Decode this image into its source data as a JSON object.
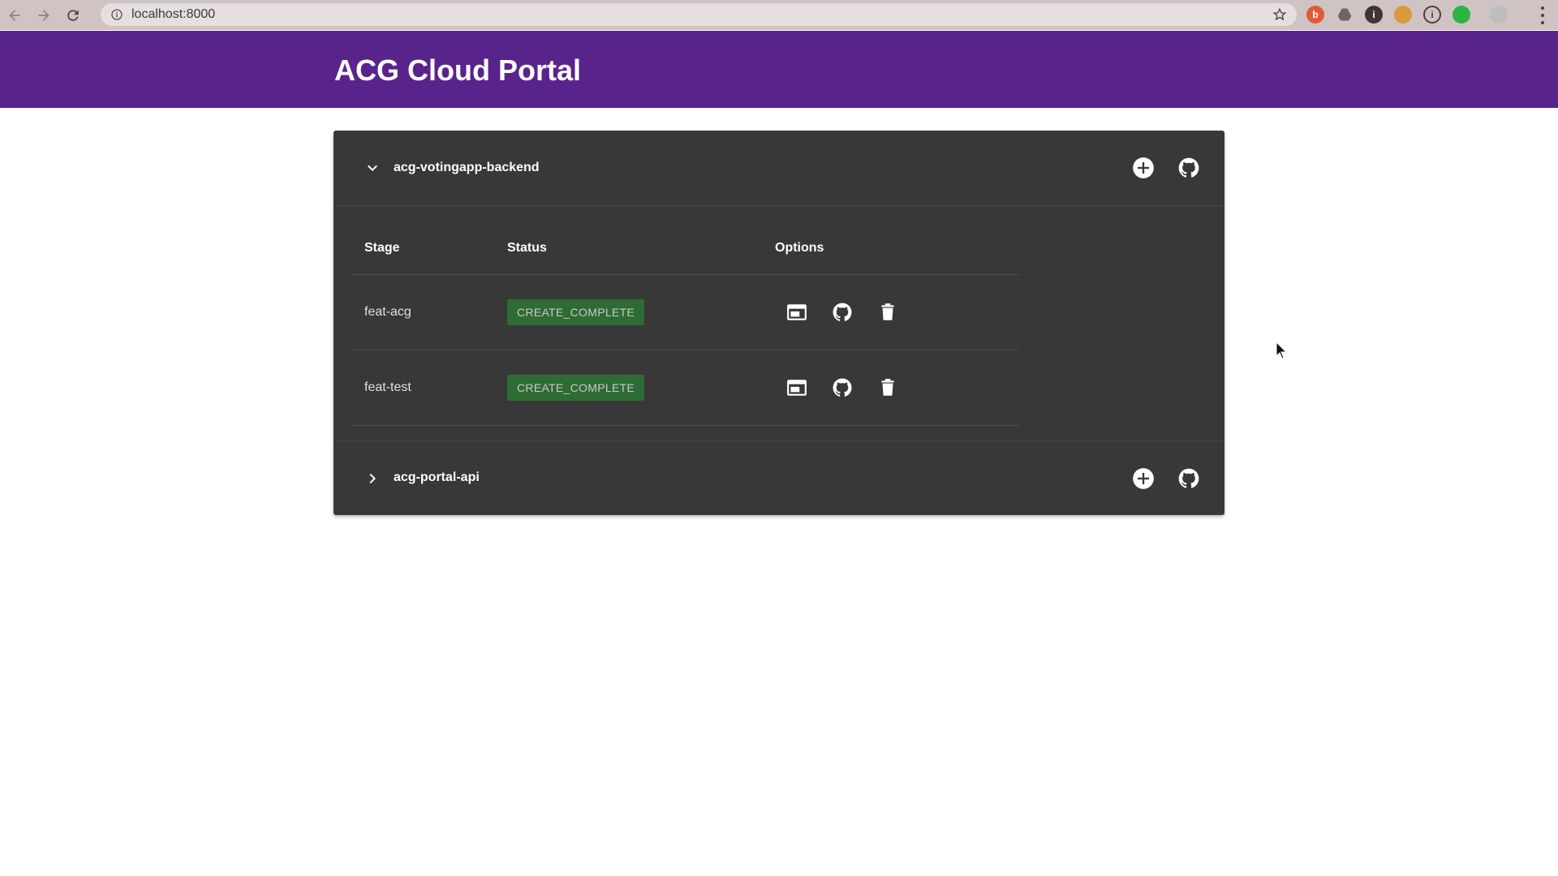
{
  "browser": {
    "url": "localhost:8000"
  },
  "app": {
    "title": "ACG Cloud Portal"
  },
  "projects": [
    {
      "name": "acg-votingapp-backend",
      "expanded": true,
      "columns": [
        "Stage",
        "Status",
        "Options"
      ],
      "stages": [
        {
          "stage": "feat-acg",
          "status": "CREATE_COMPLETE"
        },
        {
          "stage": "feat-test",
          "status": "CREATE_COMPLETE"
        }
      ]
    },
    {
      "name": "acg-portal-api",
      "expanded": false
    }
  ],
  "colors": {
    "header": "#59238c",
    "panel": "#383838",
    "badge": "#2f6b34"
  },
  "icons": [
    "back-icon",
    "forward-icon",
    "reload-icon",
    "info-icon",
    "star-icon",
    "add-circle-icon",
    "github-icon",
    "web-asset-icon",
    "trash-icon",
    "chevron-down-icon",
    "chevron-right-icon"
  ]
}
